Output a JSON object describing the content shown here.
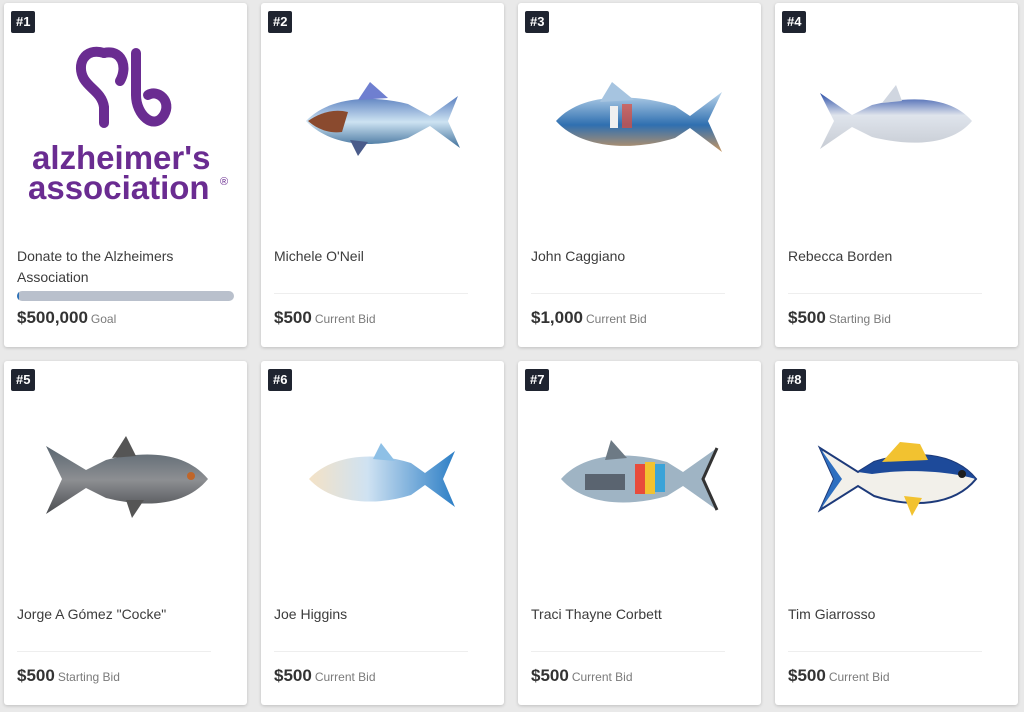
{
  "items": [
    {
      "number": "#1",
      "title": "Donate to the Alzheimers Association",
      "amount": "$500,000",
      "amount_label": "Goal",
      "progress": 0.01,
      "logo_line1": "alzheimer's",
      "logo_line2": "association",
      "logo_mark": "®"
    },
    {
      "number": "#2",
      "title": "Michele O'Neil",
      "amount": "$500",
      "amount_label": "Current Bid"
    },
    {
      "number": "#3",
      "title": "John Caggiano",
      "amount": "$1,000",
      "amount_label": "Current Bid"
    },
    {
      "number": "#4",
      "title": "Rebecca Borden",
      "amount": "$500",
      "amount_label": "Starting Bid"
    },
    {
      "number": "#5",
      "title": "Jorge A Gómez \"Cocke\"",
      "amount": "$500",
      "amount_label": "Starting Bid"
    },
    {
      "number": "#6",
      "title": "Joe Higgins",
      "amount": "$500",
      "amount_label": "Current Bid"
    },
    {
      "number": "#7",
      "title": "Traci Thayne Corbett",
      "amount": "$500",
      "amount_label": "Current Bid"
    },
    {
      "number": "#8",
      "title": "Tim Giarrosso",
      "amount": "$500",
      "amount_label": "Current Bid"
    }
  ],
  "colors": {
    "brand_purple": "#6a2c91",
    "badge": "#1f2430",
    "progress_track": "#b9c0cc"
  }
}
